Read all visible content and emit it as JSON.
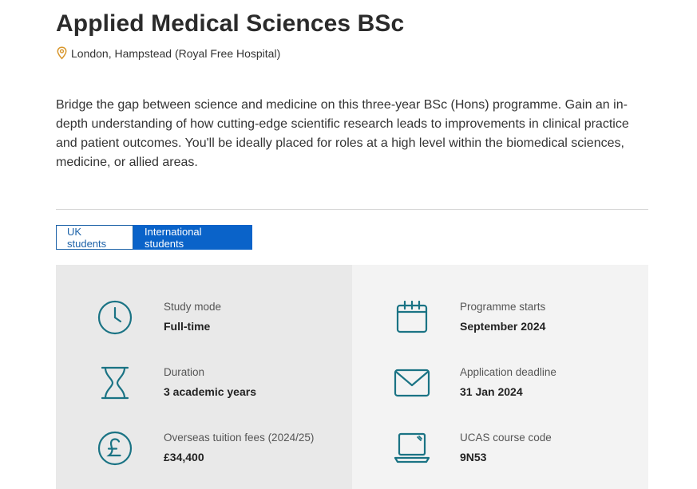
{
  "course": {
    "title": "Applied Medical Sciences BSc",
    "location": "London, Hampstead (Royal Free Hospital)",
    "intro": "Bridge the gap between science and medicine on this three-year BSc (Hons) programme. Gain an in-depth understanding of how cutting-edge scientific research leads to improvements in clinical practice and patient outcomes. You'll be ideally placed for roles at a high level within the biomedical sciences, medicine, or allied areas."
  },
  "tabs": {
    "uk": "UK students",
    "international": "International students",
    "selected": "International students"
  },
  "details": {
    "study_mode": {
      "label": "Study mode",
      "value": "Full-time",
      "icon": "clock-icon"
    },
    "duration": {
      "label": "Duration",
      "value": "3 academic years",
      "icon": "hourglass-icon"
    },
    "fees": {
      "label": "Overseas tuition fees (2024/25)",
      "value": "£34,400",
      "icon": "pound-icon"
    },
    "start": {
      "label": "Programme starts",
      "value": "September 2024",
      "icon": "calendar-icon"
    },
    "deadline": {
      "label": "Application deadline",
      "value": "31 Jan 2024",
      "icon": "envelope-icon"
    },
    "ucas": {
      "label": "UCAS course code",
      "value": "9N53",
      "icon": "laptop-icon"
    }
  },
  "colors": {
    "icon_teal": "#1a7384",
    "location_pin": "#d8962b",
    "tab_active": "#0a63c9",
    "tab_border": "#1d62a8"
  }
}
